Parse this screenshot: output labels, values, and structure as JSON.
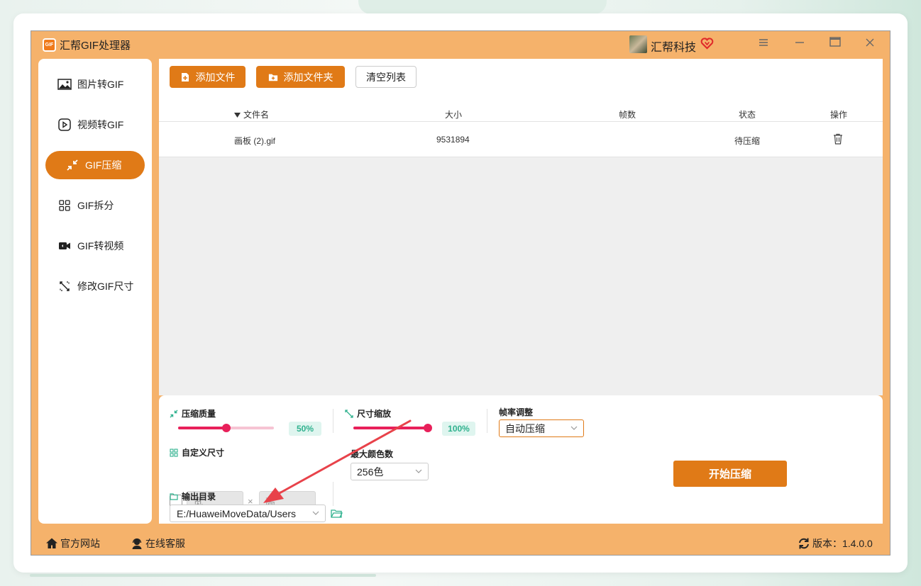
{
  "app": {
    "title": "汇帮GIF处理器",
    "logo_text": "GIF",
    "user_name": "汇帮科技",
    "window_controls": [
      "menu-icon",
      "minimize-icon",
      "maximize-icon",
      "close-icon"
    ]
  },
  "sidebar": {
    "items": [
      {
        "label": "图片转GIF",
        "icon": "image-icon"
      },
      {
        "label": "视频转GIF",
        "icon": "play-icon"
      },
      {
        "label": "GIF压缩",
        "icon": "compress-icon",
        "active": true
      },
      {
        "label": "GIF拆分",
        "icon": "grid-icon"
      },
      {
        "label": "GIF转视频",
        "icon": "video-camera-icon"
      },
      {
        "label": "修改GIF尺寸",
        "icon": "resize-icon"
      }
    ]
  },
  "toolbar": {
    "add_file": "添加文件",
    "add_folder": "添加文件夹",
    "clear_list": "清空列表"
  },
  "table": {
    "headers": {
      "name": "文件名",
      "size": "大小",
      "frames": "帧数",
      "status": "状态",
      "action": "操作"
    },
    "rows": [
      {
        "name": "画板 (2).gif",
        "size": "9531894",
        "frames": "",
        "status": "待压缩"
      }
    ]
  },
  "settings": {
    "quality": {
      "label": "压缩质量",
      "value": "50%",
      "fraction": 0.5
    },
    "scale": {
      "label": "尺寸缩放",
      "value": "100%",
      "fraction": 1.0
    },
    "framerate": {
      "label": "帧率调整",
      "selected": "自动压缩"
    },
    "custom_size": {
      "label": "自定义尺寸",
      "width_placeholder": "宽",
      "height_placeholder": "高",
      "separator": "×"
    },
    "max_colors": {
      "label": "最大颜色数",
      "selected": "256色"
    },
    "output": {
      "label": "输出目录",
      "path": "E:/HuaweiMoveData/Users"
    },
    "start_button": "开始压缩"
  },
  "footer": {
    "website": "官方网站",
    "support": "在线客服",
    "version": "版本：1.4.0.0"
  },
  "colors": {
    "accent": "#e07a17",
    "frame": "#f5b26b",
    "slider": "#e8205a",
    "teal": "#2fb18e",
    "annotation_arrow": "#e8424a"
  }
}
